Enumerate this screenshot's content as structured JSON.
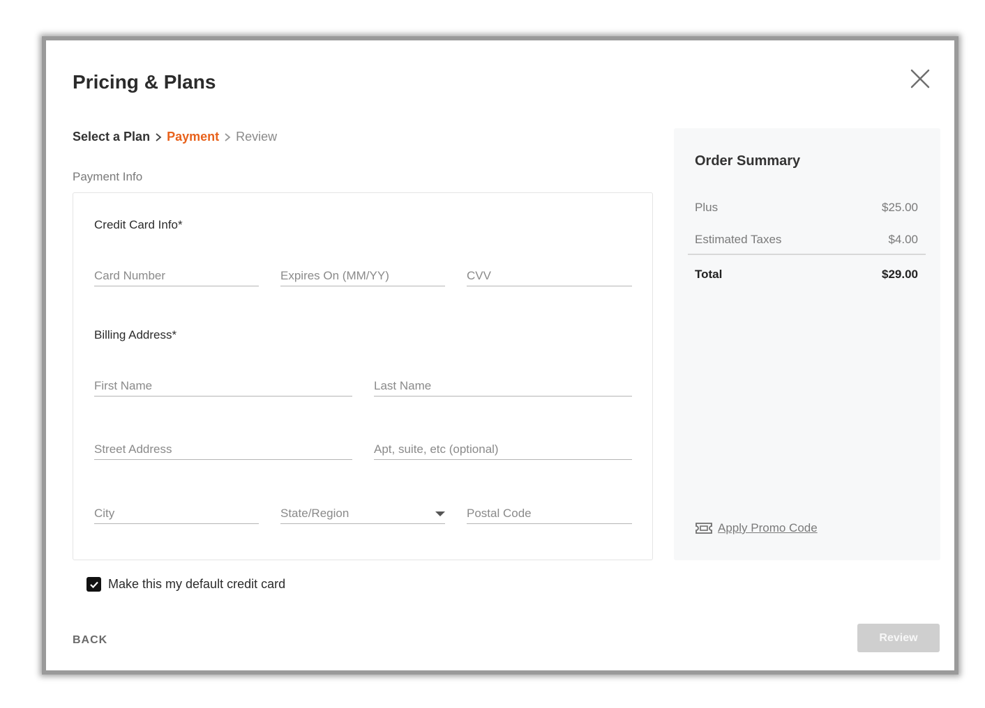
{
  "dialog": {
    "title": "Pricing & Plans"
  },
  "breadcrumb": {
    "step1": "Select a Plan",
    "step2": "Payment",
    "step3": "Review"
  },
  "payment": {
    "section_label": "Payment Info",
    "credit_card_title": "Credit Card Info*",
    "card_number_placeholder": "Card Number",
    "expires_placeholder": "Expires On (MM/YY)",
    "cvv_placeholder": "CVV",
    "billing_title": "Billing Address*",
    "first_name_placeholder": "First Name",
    "last_name_placeholder": "Last Name",
    "street_placeholder": "Street Address",
    "apt_placeholder": "Apt, suite, etc (optional)",
    "city_placeholder": "City",
    "state_placeholder": "State/Region",
    "postal_placeholder": "Postal Code"
  },
  "default_card": {
    "label": "Make this my default credit card",
    "checked": true
  },
  "footer": {
    "back_label": "BACK",
    "review_label": "Review"
  },
  "summary": {
    "title": "Order Summary",
    "items": [
      {
        "label": "Plus",
        "amount": "$25.00"
      },
      {
        "label": "Estimated Taxes",
        "amount": "$4.00"
      }
    ],
    "total_label": "Total",
    "total_amount": "$29.00",
    "promo_label": "Apply Promo Code"
  },
  "colors": {
    "accent": "#e8621c",
    "disabled_button": "#cfcfcf"
  }
}
